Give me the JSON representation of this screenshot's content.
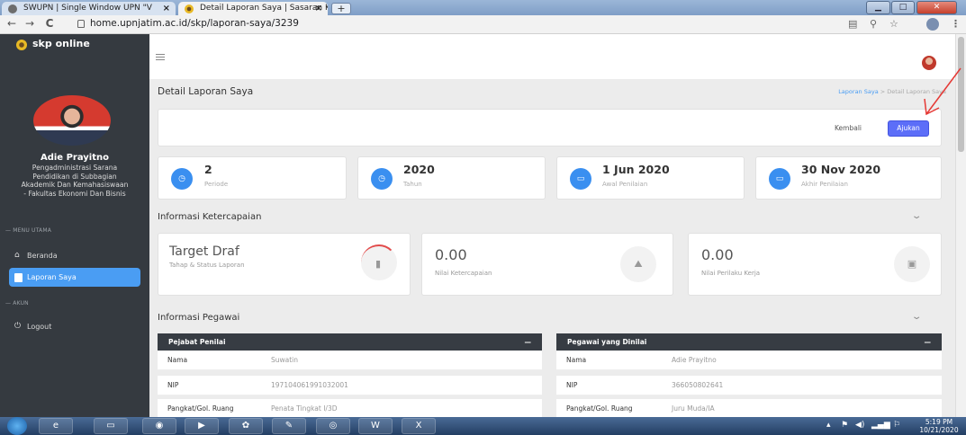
{
  "browser": {
    "tabs": [
      {
        "title": "SWUPN | Single Window UPN \"V",
        "active": false
      },
      {
        "title": "Detail Laporan Saya | Sasaran Kin",
        "active": true
      }
    ],
    "new_tab": "+",
    "url": "home.upnjatim.ac.id/skp/laporan-saya/3239",
    "controls": {
      "back": "←",
      "forward": "→",
      "reload": "C"
    }
  },
  "sidebar": {
    "app_title": "skp online",
    "user": {
      "name": "Adie Prayitno",
      "role_lines": [
        "Pengadministrasi Sarana",
        "Pendidikan di Subbagian",
        "Akademik Dan Kemahasiswaan",
        "- Fakultas Ekonomi Dan Bisnis"
      ]
    },
    "section_main": "— MENU UTAMA",
    "items_main": [
      {
        "label": "Beranda",
        "icon": "home-icon",
        "active": false
      },
      {
        "label": "Laporan Saya",
        "icon": "document-icon",
        "active": true
      }
    ],
    "section_account": "— AKUN",
    "items_account": [
      {
        "label": "Logout",
        "icon": "power-icon",
        "active": false
      }
    ]
  },
  "header": {
    "page_title": "Detail Laporan Saya",
    "breadcrumb": [
      "Laporan Saya",
      ">",
      "Detail Laporan Saya"
    ]
  },
  "actions": {
    "back_label": "Kembali",
    "submit_label": "Ajukan"
  },
  "stats": [
    {
      "value": "2",
      "label": "Periode",
      "icon": "clock-icon"
    },
    {
      "value": "2020",
      "label": "Tahun",
      "icon": "clock-icon"
    },
    {
      "value": "1 Jun 2020",
      "label": "Awal Penilaian",
      "icon": "calendar-icon"
    },
    {
      "value": "30 Nov 2020",
      "label": "Akhir Penilaian",
      "icon": "calendar-icon"
    }
  ],
  "achievement": {
    "title": "Informasi Ketercapaian",
    "cards": [
      {
        "value": "Target Draf",
        "label": "Tahap & Status Laporan",
        "icon": "document-icon"
      },
      {
        "value": "0.00",
        "label": "Nilai Ketercapaian",
        "icon": "chart-icon"
      },
      {
        "value": "0.00",
        "label": "Nilai Perilaku Kerja",
        "icon": "id-card-icon"
      }
    ]
  },
  "employee": {
    "title": "Informasi Pegawai",
    "evaluator": {
      "header": "Pejabat Penilai",
      "rows": [
        {
          "key": "Nama",
          "value": "Suwatin"
        },
        {
          "key": "NIP",
          "value": "197104061991032001"
        },
        {
          "key": "Pangkat/Gol. Ruang",
          "value": "Penata Tingkat I/3D"
        }
      ]
    },
    "evaluated": {
      "header": "Pegawai yang Dinilai",
      "rows": [
        {
          "key": "Nama",
          "value": "Adie Prayitno"
        },
        {
          "key": "NIP",
          "value": "366050802641"
        },
        {
          "key": "Pangkat/Gol. Ruang",
          "value": "Juru Muda/IA"
        }
      ]
    }
  },
  "taskbar": {
    "time": "5:19 PM",
    "date": "10/21/2020"
  },
  "colors": {
    "sidebar_bg": "#353a40",
    "accent_blue": "#3a8ff0",
    "button_purple": "#5c6ef8",
    "table_header": "#373c43",
    "annotation_arrow": "#e53935"
  }
}
